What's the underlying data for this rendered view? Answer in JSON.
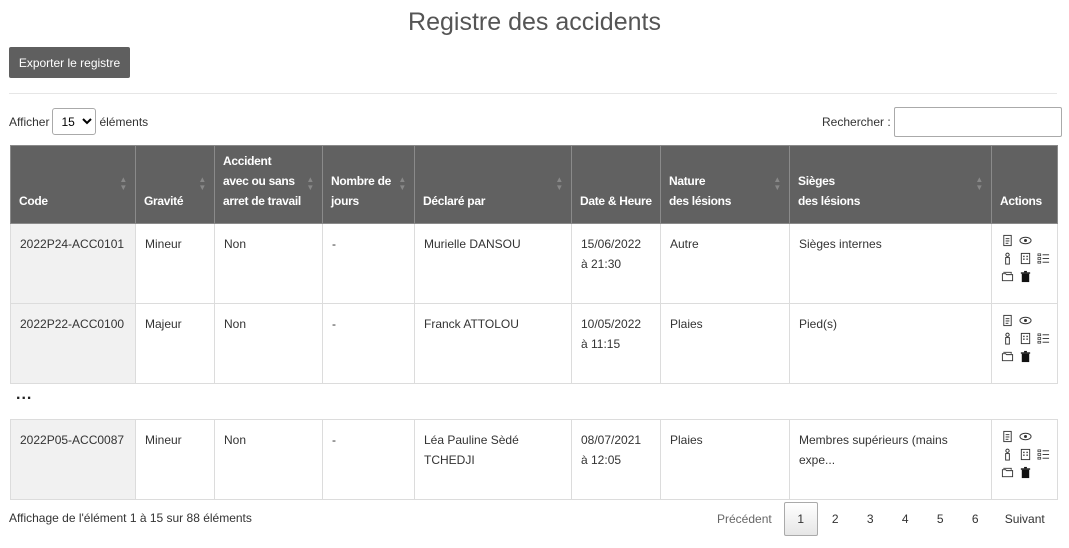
{
  "title": "Registre des accidents",
  "export_label": "Exporter le registre",
  "length": {
    "prefix": "Afficher",
    "value": "15",
    "suffix": "éléments"
  },
  "search": {
    "label": "Rechercher :",
    "value": ""
  },
  "columns": [
    "Code",
    "Gravité",
    "Accident avec ou sans arret de travail",
    "Nombre de jours",
    "Déclaré par",
    "Date & Heure",
    "Nature des lésions",
    "Sièges des lésions",
    "Actions"
  ],
  "columns_html": {
    "code": "Code",
    "gravite": "Gravité",
    "accident_l1": "Accident",
    "accident_l2": "avec ou sans",
    "accident_l3": "arret de travail",
    "jours_l1": "Nombre de",
    "jours_l2": "jours",
    "declare": "Déclaré par",
    "date": "Date & Heure",
    "nature_l1": "Nature",
    "nature_l2": "des lésions",
    "sieges_l1": "Sièges",
    "sieges_l2": "des lésions",
    "actions": "Actions"
  },
  "rows": [
    {
      "code": "2022P24-ACC0101",
      "gravite": "Mineur",
      "arret": "Non",
      "jours": "-",
      "declare": "Murielle DANSOU",
      "date": "15/06/2022",
      "heure": "à 21:30",
      "nature": "Autre",
      "sieges": "Sièges internes"
    },
    {
      "code": "2022P22-ACC0100",
      "gravite": "Majeur",
      "arret": "Non",
      "jours": "-",
      "declare": "Franck ATTOLOU",
      "date": "10/05/2022",
      "heure": "à 11:15",
      "nature": "Plaies",
      "sieges": "Pied(s)"
    },
    {
      "code": "2022P05-ACC0087",
      "gravite": "Mineur",
      "arret": "Non",
      "jours": "-",
      "declare": "Léa Pauline Sèdé TCHEDJI",
      "date": "08/07/2021",
      "heure": "à 12:05",
      "nature": "Plaies",
      "sieges": "Membres supérieurs (mains expe..."
    }
  ],
  "ellipsis": "...",
  "info": "Affichage de l'élément 1 à 15 sur 88 éléments",
  "pager": {
    "prev": "Précédent",
    "pages": [
      "1",
      "2",
      "3",
      "4",
      "5",
      "6"
    ],
    "next": "Suivant",
    "current": "1"
  }
}
